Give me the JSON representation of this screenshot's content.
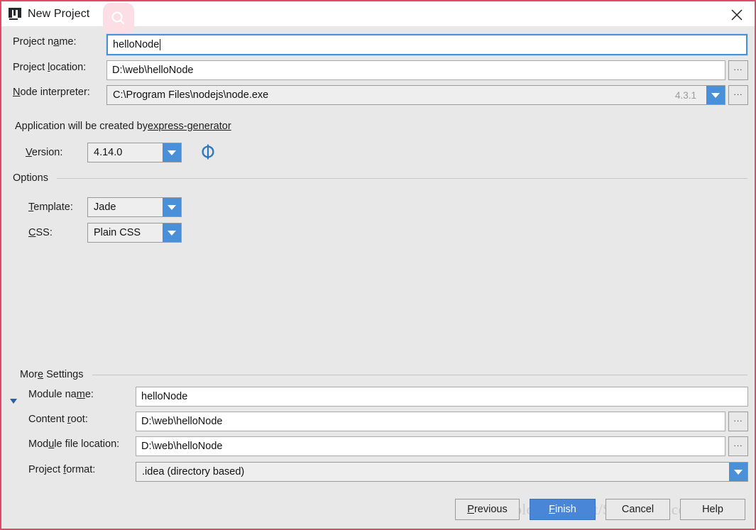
{
  "window": {
    "title": "New Project",
    "app_icon": "intellij-idea-icon",
    "search_watermark_icon": "search-icon",
    "close_icon": "close-icon"
  },
  "form": {
    "project_name": {
      "label": "Project name:",
      "label_mnemonic": "a",
      "value": "helloNode",
      "focused": true
    },
    "project_location": {
      "label": "Project location:",
      "label_mnemonic": "l",
      "value": "D:\\web\\helloNode",
      "browse_label": "..."
    },
    "node_interpreter": {
      "label": "Node interpreter:",
      "label_mnemonic": "N",
      "value": "C:\\Program Files\\nodejs\\node.exe",
      "version_hint": "4.3.1",
      "browse_label": "..."
    },
    "generator_note": {
      "text_before": "Application will be created by ",
      "link_text": "express-generator"
    },
    "version": {
      "label": "Version:",
      "label_mnemonic": "V",
      "value": "4.14.0",
      "refresh_icon": "refresh-icon"
    }
  },
  "options": {
    "group_title": "Options",
    "template": {
      "label": "Template:",
      "label_mnemonic": "T",
      "value": "Jade"
    },
    "css": {
      "label": "CSS:",
      "label_mnemonic": "C",
      "value": "Plain CSS"
    }
  },
  "more_settings": {
    "group_title": "More Settings",
    "group_mnemonic": "e",
    "expanded": true,
    "module_name": {
      "label": "Module name:",
      "label_mnemonic": "m",
      "value": "helloNode"
    },
    "content_root": {
      "label": "Content root:",
      "label_mnemonic": "r",
      "value": "D:\\web\\helloNode",
      "browse_label": "..."
    },
    "module_file_location": {
      "label": "Module file location:",
      "label_mnemonic": "u",
      "value": "D:\\web\\helloNode",
      "browse_label": "..."
    },
    "project_format": {
      "label": "Project format:",
      "label_mnemonic": "f",
      "value": ".idea (directory based)"
    }
  },
  "footer": {
    "previous": "Previous",
    "previous_mnemonic": "P",
    "finish": "Finish",
    "finish_mnemonic": "F",
    "cancel": "Cancel",
    "help": "Help"
  },
  "watermark": {
    "text": "https://blog.csdn.net/StubbornAccepted"
  },
  "colors": {
    "dialog_border": "#e04a68",
    "background": "#e8e8e8",
    "accent_blue": "#4a90d9",
    "primary_button": "#4a86d8",
    "watermark_pink": "#fbdfe4"
  }
}
